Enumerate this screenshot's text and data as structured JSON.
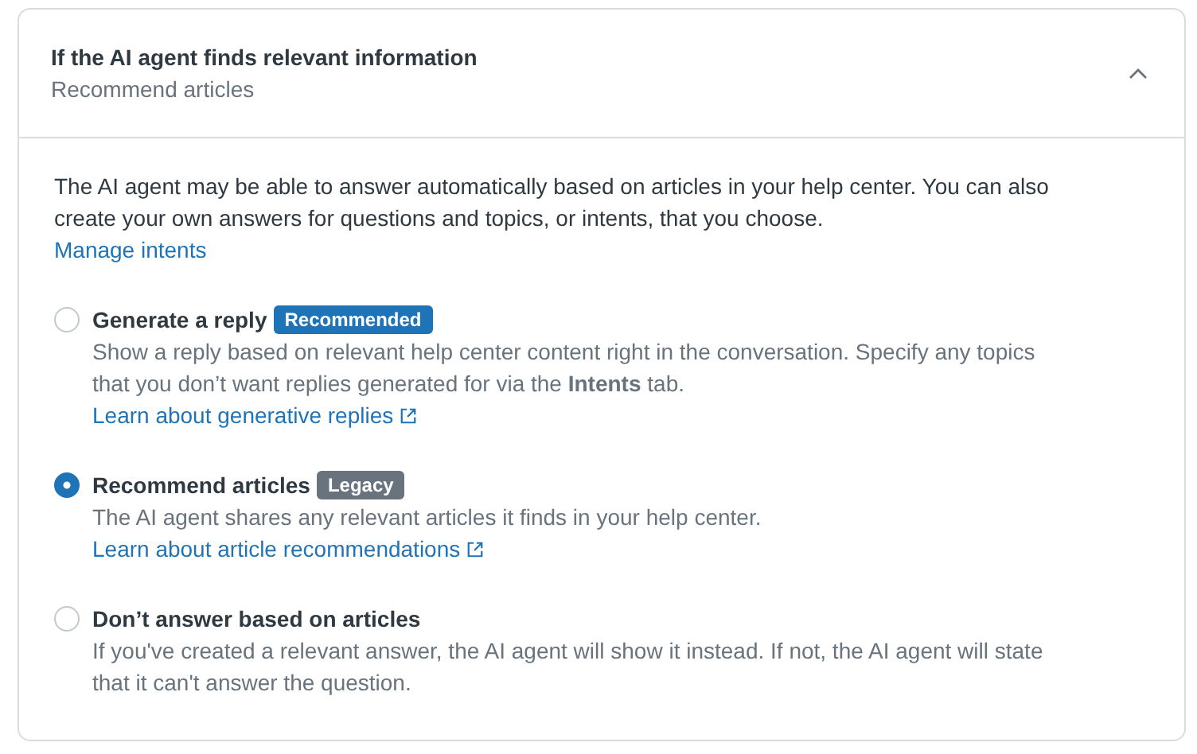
{
  "panel": {
    "title": "If the AI agent finds relevant information",
    "subtitle": "Recommend articles",
    "expanded": true
  },
  "intro": "The AI agent may be able to answer automatically based on articles in your help center. You can also create your own answers for questions and topics, or intents, that you choose.",
  "intro_link": "Manage intents",
  "options": [
    {
      "label": "Generate a reply",
      "selected": false,
      "badge": {
        "text": "Recommended",
        "color": "#1f73b7"
      },
      "description": "Show a reply based on relevant help center content right in the conversation. Specify any topics that you don’t want replies generated for via the **Intents** tab.",
      "link": "Learn about generative replies"
    },
    {
      "label": "Recommend articles",
      "selected": true,
      "badge": {
        "text": "Legacy",
        "color": "#68737d"
      },
      "description": "The AI agent shares any relevant articles it finds in your help center.",
      "link": "Learn about article recommendations"
    },
    {
      "label": "Don’t answer based on articles",
      "selected": false,
      "description": "If you've created a relevant answer, the AI agent will show it instead. If not, the AI agent will state that it can't answer the question."
    }
  ]
}
